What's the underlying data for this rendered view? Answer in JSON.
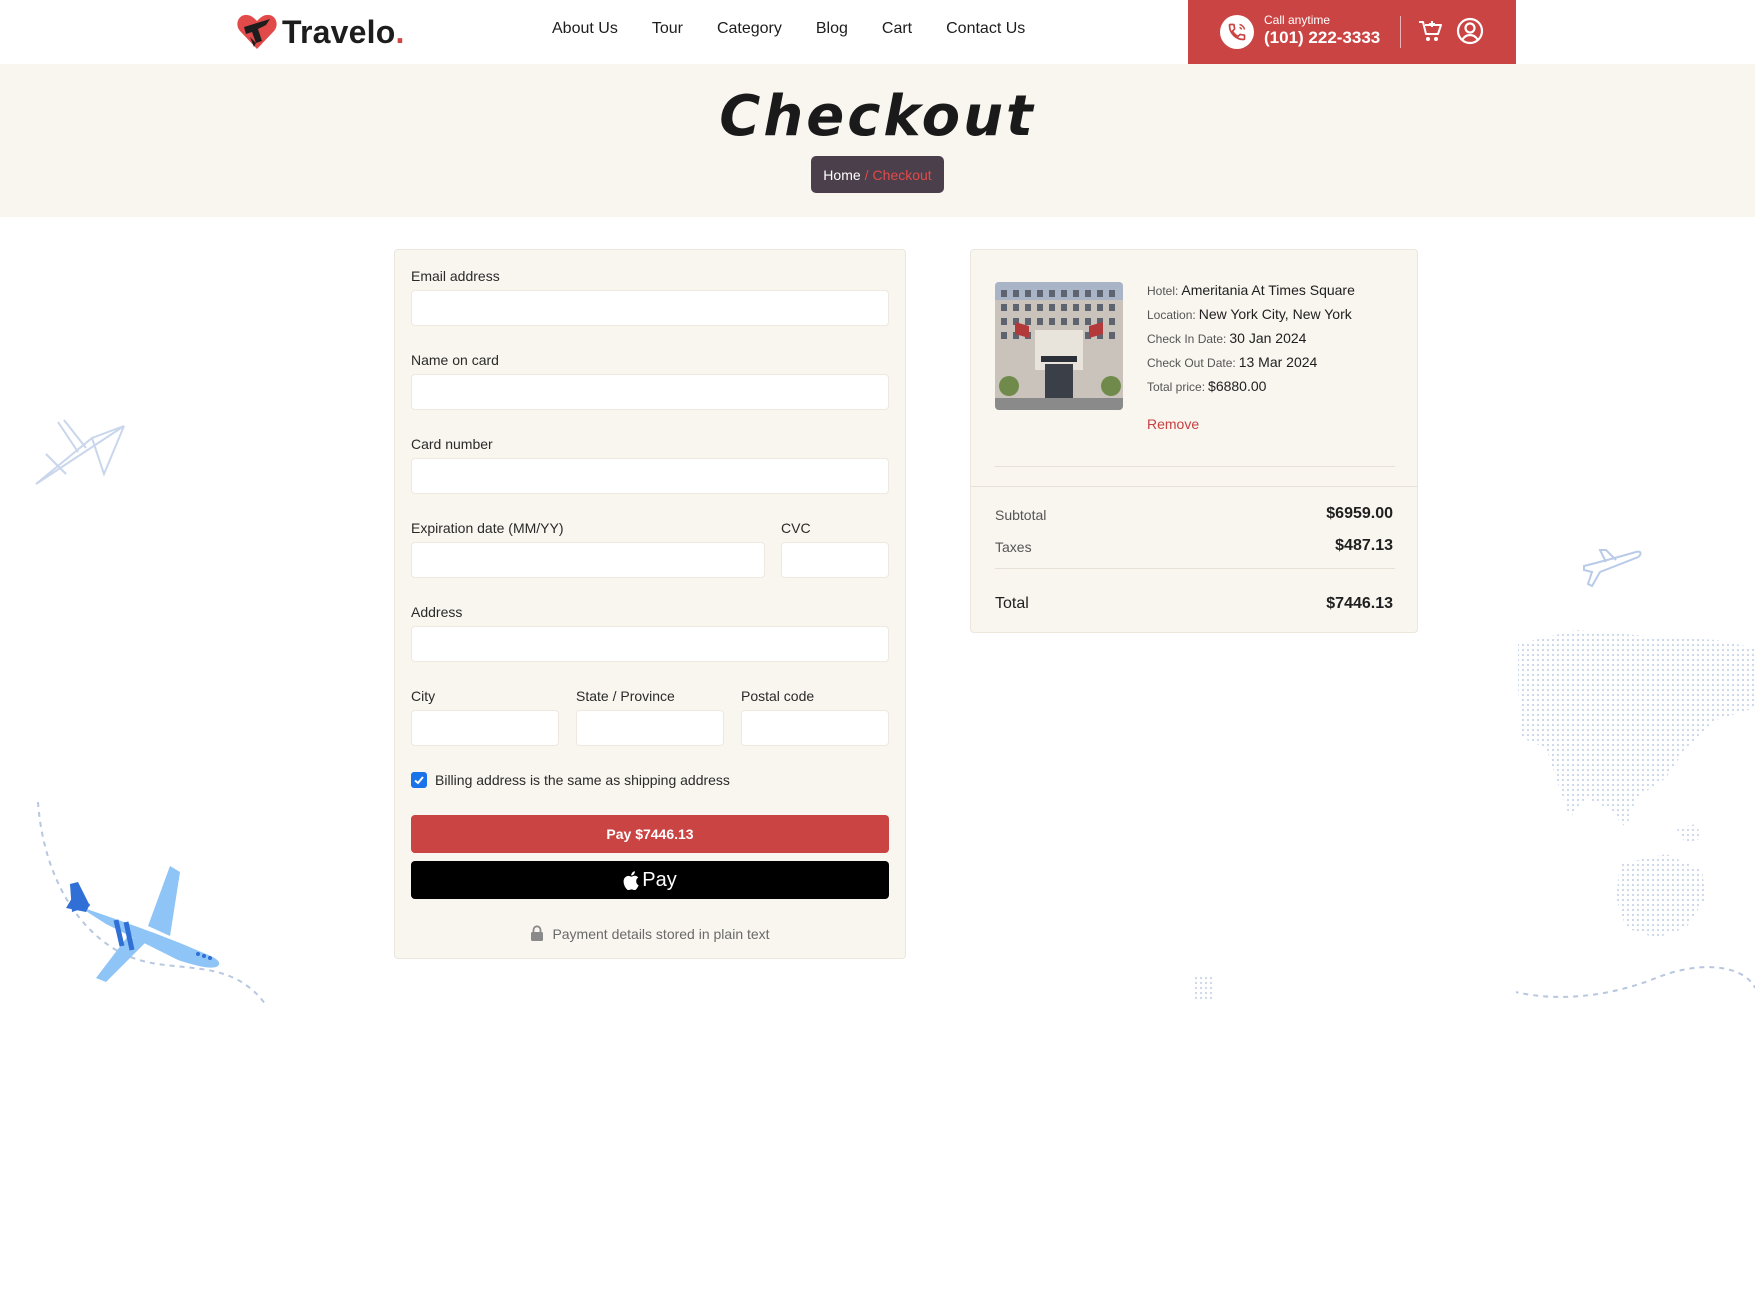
{
  "brand": {
    "name": "Travelo",
    "dot": ".",
    "accent_color": "#d24545"
  },
  "nav": {
    "items": [
      "About Us",
      "Tour",
      "Category",
      "Blog",
      "Cart",
      "Contact Us"
    ]
  },
  "callbar": {
    "label": "Call anytime",
    "number": "(101) 222-3333",
    "background": "#cb4444"
  },
  "banner": {
    "title": "Checkout",
    "breadcrumb": {
      "home": "Home",
      "separator": "/",
      "current": "Checkout"
    }
  },
  "form": {
    "email_label": "Email address",
    "name_label": "Name on card",
    "card_label": "Card number",
    "expiry_label": "Expiration date (MM/YY)",
    "cvc_label": "CVC",
    "address_label": "Address",
    "city_label": "City",
    "state_label": "State / Province",
    "postal_label": "Postal code",
    "billing_same_label": "Billing address is the same as shipping address",
    "billing_same_checked": true,
    "pay_button": "Pay $7446.13",
    "apple_pay_label": "Pay",
    "secure_note": "Payment details stored in plain text"
  },
  "summary": {
    "hotel_key": "Hotel:",
    "hotel": "Ameritania At Times Square",
    "location_key": "Location:",
    "location": "New York City, New York",
    "checkin_key": "Check In Date:",
    "checkin": "30 Jan 2024",
    "checkout_key": "Check Out Date:",
    "checkout": "13 Mar 2024",
    "price_key": "Total price:",
    "price": "$6880.00",
    "remove": "Remove",
    "subtotal_label": "Subtotal",
    "subtotal": "$6959.00",
    "taxes_label": "Taxes",
    "taxes": "$487.13",
    "total_label": "Total",
    "total": "$7446.13"
  }
}
